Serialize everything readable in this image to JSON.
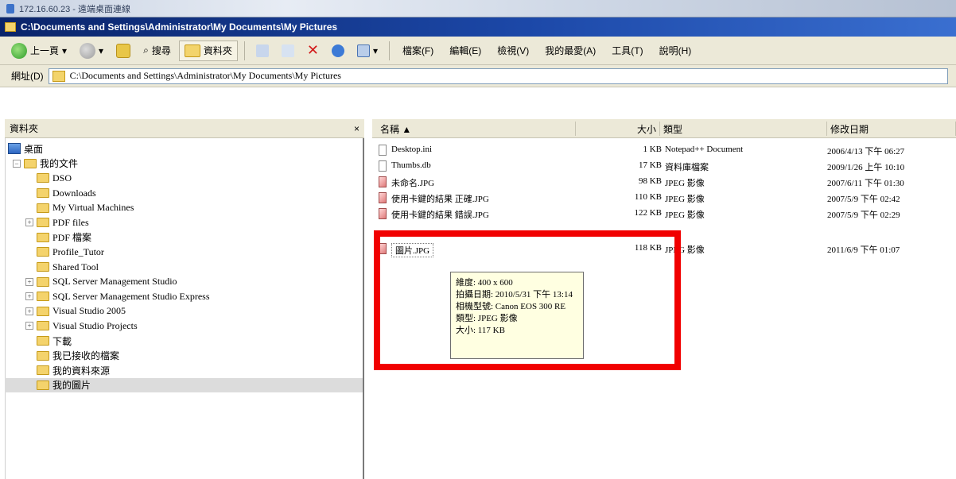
{
  "rdp_bar": {
    "title": "172.16.60.23 - 遠端桌面連線"
  },
  "window": {
    "title": "C:\\Documents and Settings\\Administrator\\My Documents\\My Pictures"
  },
  "toolbar": {
    "back_label": "上一頁",
    "search_label": "搜尋",
    "folders_label": "資料夾",
    "menus": [
      "檔案(F)",
      "編輯(E)",
      "檢視(V)",
      "我的最愛(A)",
      "工具(T)",
      "說明(H)"
    ]
  },
  "address": {
    "label": "網址(D)",
    "value": "C:\\Documents and Settings\\Administrator\\My Documents\\My Pictures"
  },
  "folders_pane": {
    "title": "資料夾",
    "close": "×",
    "items": [
      {
        "label": "桌面"
      },
      {
        "label": "我的文件"
      },
      {
        "label": "DSO"
      },
      {
        "label": "Downloads"
      },
      {
        "label": "My Virtual Machines"
      },
      {
        "label": "PDF files"
      },
      {
        "label": "PDF 檔案"
      },
      {
        "label": "Profile_Tutor"
      },
      {
        "label": "Shared Tool"
      },
      {
        "label": "SQL Server Management Studio"
      },
      {
        "label": "SQL Server Management Studio Express"
      },
      {
        "label": "Visual Studio 2005"
      },
      {
        "label": "Visual Studio Projects"
      },
      {
        "label": "下載"
      },
      {
        "label": "我已接收的檔案"
      },
      {
        "label": "我的資料來源"
      },
      {
        "label": "我的圖片"
      }
    ]
  },
  "file_list": {
    "columns": {
      "name": "名稱 ▲",
      "size": "大小",
      "type": "類型",
      "modified": "修改日期"
    },
    "rows": [
      {
        "name": "Desktop.ini",
        "size": "1 KB",
        "type": "Notepad++ Document",
        "modified": "2006/4/13 下午 06:27"
      },
      {
        "name": "Thumbs.db",
        "size": "17 KB",
        "type": "資料庫檔案",
        "modified": "2009/1/26 上午 10:10"
      },
      {
        "name": "未命名.JPG",
        "size": "98 KB",
        "type": "JPEG 影像",
        "modified": "2007/6/11 下午 01:30"
      },
      {
        "name": "使用卡鍵的結果 正確.JPG",
        "size": "110 KB",
        "type": "JPEG 影像",
        "modified": "2007/5/9 下午 02:42"
      },
      {
        "name": "使用卡鍵的結果 錯誤.JPG",
        "size": "122 KB",
        "type": "JPEG 影像",
        "modified": "2007/5/9 下午 02:29"
      },
      {
        "name": "圖片.JPG",
        "size": "118 KB",
        "type": "JPEG 影像",
        "modified": "2011/6/9 下午 01:07"
      }
    ]
  },
  "tooltip": {
    "lines": [
      "維度: 400 x 600",
      "拍攝日期: 2010/5/31 下午 13:14",
      "相機型號: Canon EOS 300 RE",
      "類型: JPEG 影像",
      "大小: 117 KB"
    ]
  },
  "colors": {
    "highlight": "#f10000",
    "title_bar": "#0a246a",
    "tooltip_bg": "#ffffe1"
  }
}
